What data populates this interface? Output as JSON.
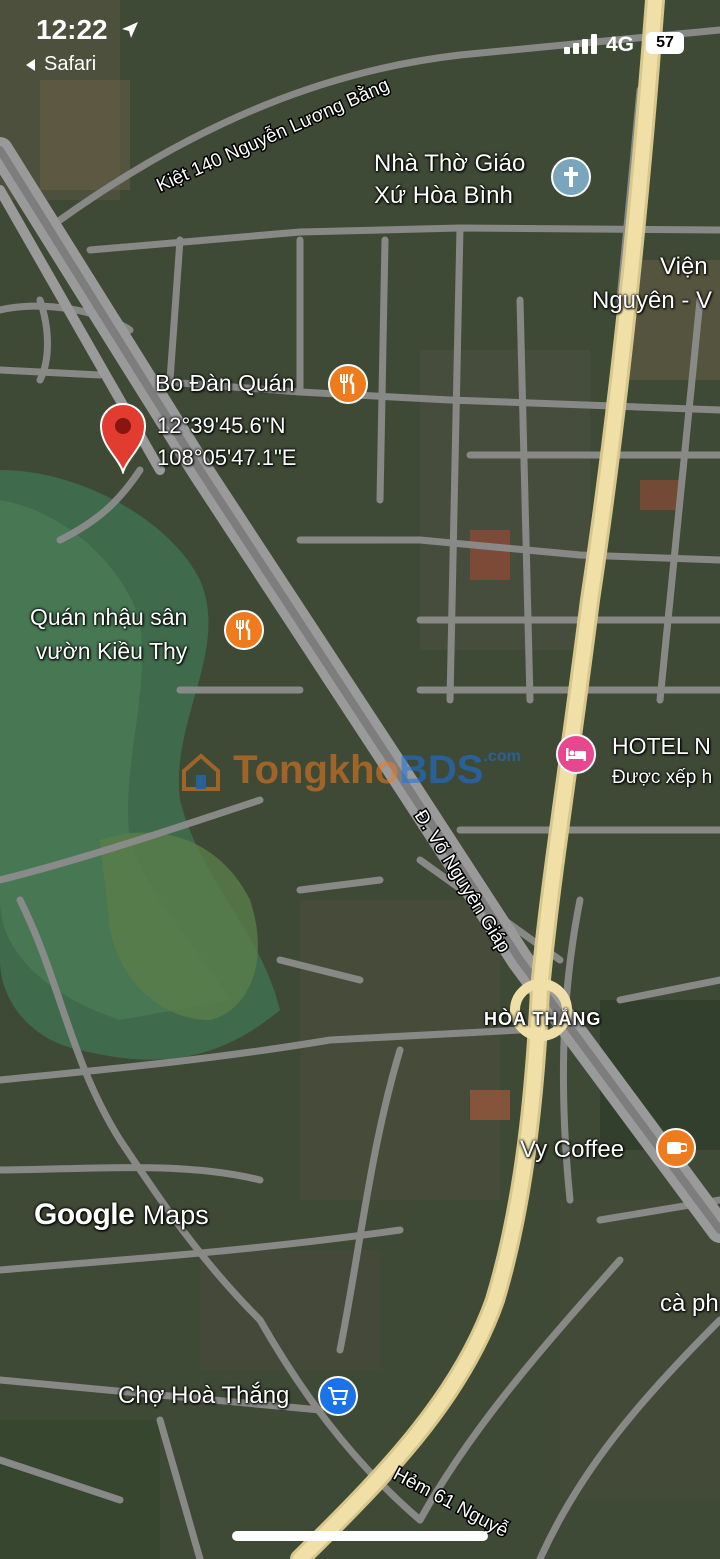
{
  "status_bar": {
    "time": "12:22",
    "back_app": "Safari",
    "network": "4G",
    "battery": "57"
  },
  "colors": {
    "highway": "#f0e0a8",
    "road": "#8c8c8c",
    "pin": "#e23b30",
    "restaurant": "#f07b1d",
    "church": "#7aa6bd",
    "hotel": "#e8478f",
    "cafe": "#f07b1d",
    "shop": "#1a73e8"
  },
  "pin": {
    "coord_lat": "12°39'45.6\"N",
    "coord_lng": "108°05'47.1\"E"
  },
  "roads": {
    "kiet_140": "Kiệt 140 Nguyễn Lương Bằng",
    "vo_nguyen_giap": "Đ. Võ Nguyên Giáp",
    "hem_61": "Hẻm 61 Nguyễ"
  },
  "places": {
    "church_line1": "Nhà Thờ Giáo",
    "church_line2": "Xứ Hòa Bình",
    "vien_line1": "Viện",
    "vien_line2": "Nguyên - V",
    "bo_dan": "Bo Đàn Quán",
    "quan_nhau_line1": "Quán nhậu sân",
    "quan_nhau_line2": "vườn Kiều Thy",
    "hotel_line1": "HOTEL N",
    "hotel_line2": "Được xếp h",
    "hoa_thang": "HÒA THẮNG",
    "vy_coffee": "Vy Coffee",
    "ca_phe": "cà ph",
    "cho_hoa_thang": "Chợ Hoà Thắng"
  },
  "watermark": {
    "google": "Google",
    "maps": "Maps",
    "tongkho_a": "Tongkho",
    "tongkho_b": "BDS",
    "tongkho_c": ".com"
  },
  "icons": {
    "location_arrow": "location-arrow-icon",
    "back": "back-chevron-icon",
    "signal": "signal-bars-icon",
    "battery": "battery-icon",
    "pin": "map-pin-icon",
    "restaurant": "fork-knife-icon",
    "church": "cross-icon",
    "hotel": "bed-icon",
    "cafe": "coffee-cup-icon",
    "shop": "shopping-cart-icon"
  }
}
